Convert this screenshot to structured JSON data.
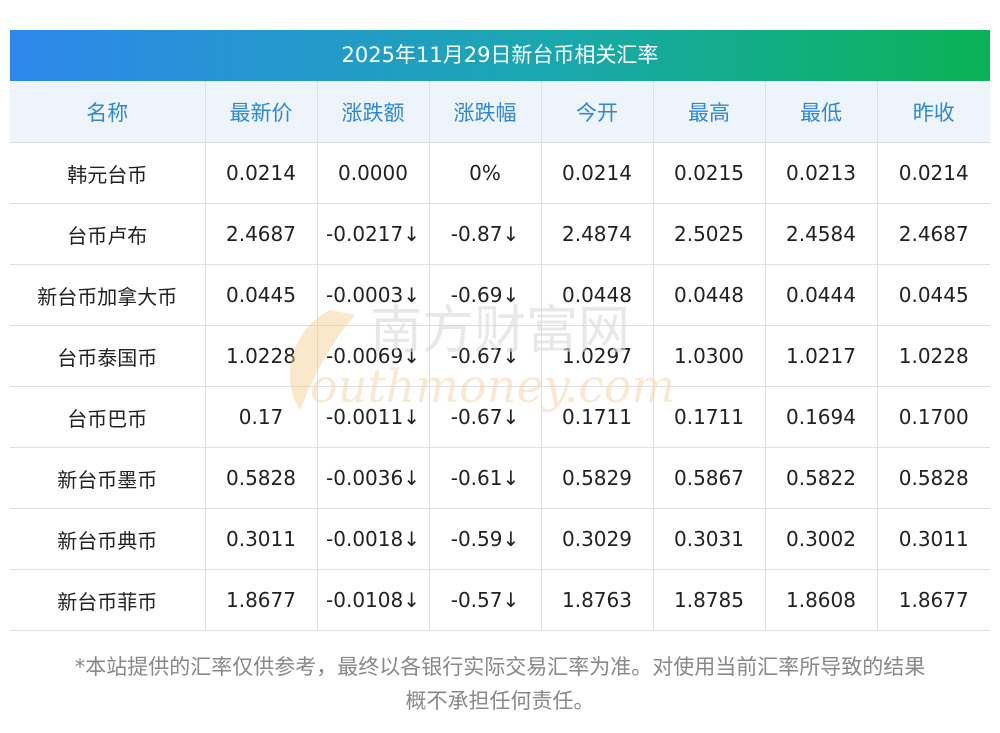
{
  "title": "2025年11月29日新台币相关汇率",
  "columns": [
    "名称",
    "最新价",
    "涨跌额",
    "涨跌幅",
    "今开",
    "最高",
    "最低",
    "昨收"
  ],
  "rows": [
    {
      "name": "韩元台币",
      "latest": "0.0214",
      "change": "0.0000",
      "change_pct": "0%",
      "open": "0.0214",
      "high": "0.0215",
      "low": "0.0213",
      "prev_close": "0.0214",
      "direction": "flat"
    },
    {
      "name": "台币卢布",
      "latest": "2.4687",
      "change": "-0.0217↓",
      "change_pct": "-0.87↓",
      "open": "2.4874",
      "high": "2.5025",
      "low": "2.4584",
      "prev_close": "2.4687",
      "direction": "down"
    },
    {
      "name": "新台币加拿大币",
      "latest": "0.0445",
      "change": "-0.0003↓",
      "change_pct": "-0.69↓",
      "open": "0.0448",
      "high": "0.0448",
      "low": "0.0444",
      "prev_close": "0.0445",
      "direction": "down"
    },
    {
      "name": "台币泰国币",
      "latest": "1.0228",
      "change": "-0.0069↓",
      "change_pct": "-0.67↓",
      "open": "1.0297",
      "high": "1.0300",
      "low": "1.0217",
      "prev_close": "1.0228",
      "direction": "down"
    },
    {
      "name": "台币巴币",
      "latest": "0.17",
      "change": "-0.0011↓",
      "change_pct": "-0.67↓",
      "open": "0.1711",
      "high": "0.1711",
      "low": "0.1694",
      "prev_close": "0.1700",
      "direction": "down"
    },
    {
      "name": "新台币墨币",
      "latest": "0.5828",
      "change": "-0.0036↓",
      "change_pct": "-0.61↓",
      "open": "0.5829",
      "high": "0.5867",
      "low": "0.5822",
      "prev_close": "0.5828",
      "direction": "down"
    },
    {
      "name": "新台币典币",
      "latest": "0.3011",
      "change": "-0.0018↓",
      "change_pct": "-0.59↓",
      "open": "0.3029",
      "high": "0.3031",
      "low": "0.3002",
      "prev_close": "0.3011",
      "direction": "down"
    },
    {
      "name": "新台币菲币",
      "latest": "1.8677",
      "change": "-0.0108↓",
      "change_pct": "-0.57↓",
      "open": "1.8763",
      "high": "1.8785",
      "low": "1.8608",
      "prev_close": "1.8677",
      "direction": "down"
    }
  ],
  "watermark": {
    "cn": "南方财富网",
    "en": "outhmoney.com"
  },
  "footnote": {
    "line1": "*本站提供的汇率仅供参考，最终以各银行实际交易汇率为准。对使用当前汇率所导致的结果",
    "line2": "概不承担任何责任。"
  },
  "colors": {
    "header_text": "#2f87d8",
    "down": "#1b8a1b",
    "header_bg": "#edf4fb"
  }
}
